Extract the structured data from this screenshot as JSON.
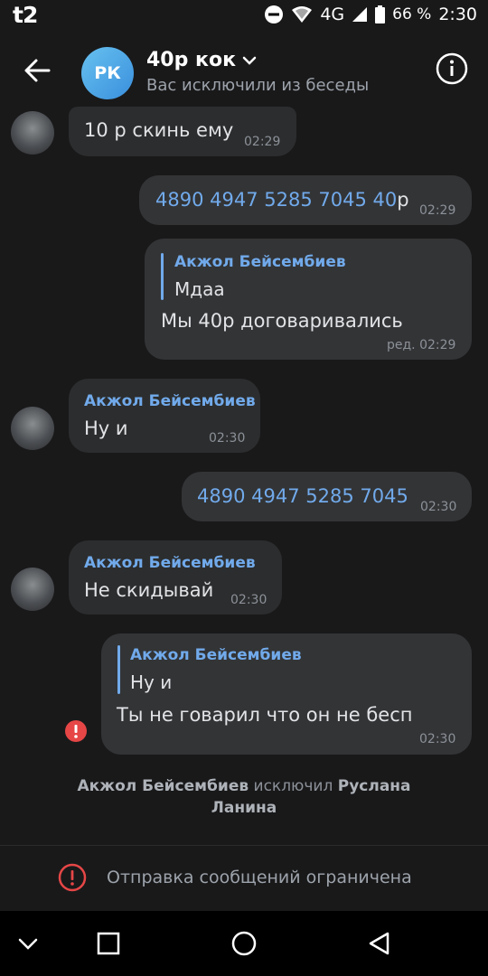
{
  "status_bar": {
    "carrier": "t2",
    "network": "4G",
    "battery": "66 %",
    "time": "2:30"
  },
  "header": {
    "avatar_initials": "РК",
    "title": "40р кок",
    "subtitle": "Вас исключили из беседы"
  },
  "messages": [
    {
      "text": "10 р скинь ему",
      "time": "02:29"
    },
    {
      "text": "4890 4947 5285 7045 40р",
      "link_part": "4890 4947 5285 7045 40",
      "suffix": "р",
      "time": "02:29"
    },
    {
      "reply_author": "Акжол Бейсембиев",
      "reply_text": "Мдаа",
      "text": "Мы 40р договаривались",
      "time": "ред. 02:29"
    },
    {
      "author": "Акжол Бейсембиев",
      "text": "Ну и",
      "time": "02:30"
    },
    {
      "text": "4890 4947 5285 7045",
      "time": "02:30"
    },
    {
      "author": "Акжол Бейсембиев",
      "text": "Не скидывай",
      "time": "02:30"
    },
    {
      "reply_author": "Акжол Бейсембиев",
      "reply_text": "Ну и",
      "text": "Ты не говарил что он не бесп",
      "time": "02:30"
    }
  ],
  "system": {
    "actor": "Акжол Бейсембиев",
    "action": "исключил",
    "target": "Руслана Ланина"
  },
  "restricted": {
    "text": "Отправка сообщений ограничена"
  },
  "colors": {
    "background": "#19191a",
    "bubble_out": "#333436",
    "bubble_in": "#2c2d2e",
    "link": "#71aaeb",
    "error": "#e64646"
  }
}
